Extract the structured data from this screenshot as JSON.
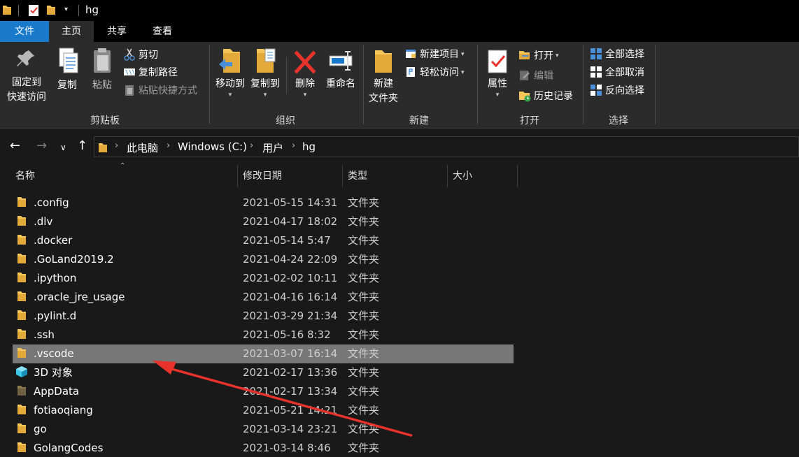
{
  "window": {
    "title": "hg"
  },
  "tabs": {
    "file": "文件",
    "home": "主页",
    "share": "共享",
    "view": "查看"
  },
  "ribbon": {
    "clipboard": {
      "label": "剪贴板",
      "pin_line1": "固定到",
      "pin_line2": "快速访问",
      "copy": "复制",
      "paste": "粘贴",
      "cut": "剪切",
      "copy_path": "复制路径",
      "paste_shortcut": "粘贴快捷方式"
    },
    "organize": {
      "label": "组织",
      "move_to": "移动到",
      "copy_to": "复制到",
      "delete": "删除",
      "rename": "重命名"
    },
    "new": {
      "label": "新建",
      "new_folder_line1": "新建",
      "new_folder_line2": "文件夹",
      "new_item": "新建项目",
      "easy_access": "轻松访问"
    },
    "open": {
      "label": "打开",
      "properties": "属性",
      "open": "打开",
      "edit": "编辑",
      "history": "历史记录"
    },
    "select": {
      "label": "选择",
      "select_all": "全部选择",
      "select_none": "全部取消",
      "invert": "反向选择"
    }
  },
  "address": {
    "crumbs": [
      "此电脑",
      "Windows (C:)",
      "用户",
      "hg"
    ]
  },
  "columns": {
    "name": "名称",
    "modified": "修改日期",
    "type": "类型",
    "size": "大小"
  },
  "files": [
    {
      "name": ".config",
      "date": "2021-05-15 14:31",
      "type": "文件夹",
      "icon": "folder-icon"
    },
    {
      "name": ".dlv",
      "date": "2021-04-17 18:02",
      "type": "文件夹",
      "icon": "folder-icon"
    },
    {
      "name": ".docker",
      "date": "2021-05-14 5:47",
      "type": "文件夹",
      "icon": "folder-icon"
    },
    {
      "name": ".GoLand2019.2",
      "date": "2021-04-24 22:09",
      "type": "文件夹",
      "icon": "folder-icon"
    },
    {
      "name": ".ipython",
      "date": "2021-02-02 10:11",
      "type": "文件夹",
      "icon": "folder-icon"
    },
    {
      "name": ".oracle_jre_usage",
      "date": "2021-04-16 16:14",
      "type": "文件夹",
      "icon": "folder-icon"
    },
    {
      "name": ".pylint.d",
      "date": "2021-03-29 21:34",
      "type": "文件夹",
      "icon": "folder-icon"
    },
    {
      "name": ".ssh",
      "date": "2021-05-16 8:32",
      "type": "文件夹",
      "icon": "folder-icon"
    },
    {
      "name": ".vscode",
      "date": "2021-03-07 16:14",
      "type": "文件夹",
      "icon": "folder-icon",
      "selected": true
    },
    {
      "name": "3D 对象",
      "date": "2021-02-17 13:36",
      "type": "文件夹",
      "icon": "3d-objects-icon"
    },
    {
      "name": "AppData",
      "date": "2021-02-17 13:34",
      "type": "文件夹",
      "icon": "hidden-folder-icon"
    },
    {
      "name": "fotiaoqiang",
      "date": "2021-05-21 14:21",
      "type": "文件夹",
      "icon": "folder-icon"
    },
    {
      "name": "go",
      "date": "2021-03-14 23:21",
      "type": "文件夹",
      "icon": "folder-icon"
    },
    {
      "name": "GolangCodes",
      "date": "2021-03-14 8:46",
      "type": "文件夹",
      "icon": "folder-icon"
    }
  ],
  "colors": {
    "accent": "#1979ca",
    "selected_row": "#777777",
    "annotation_arrow": "#e8332d",
    "folder": "#f4c65a"
  }
}
